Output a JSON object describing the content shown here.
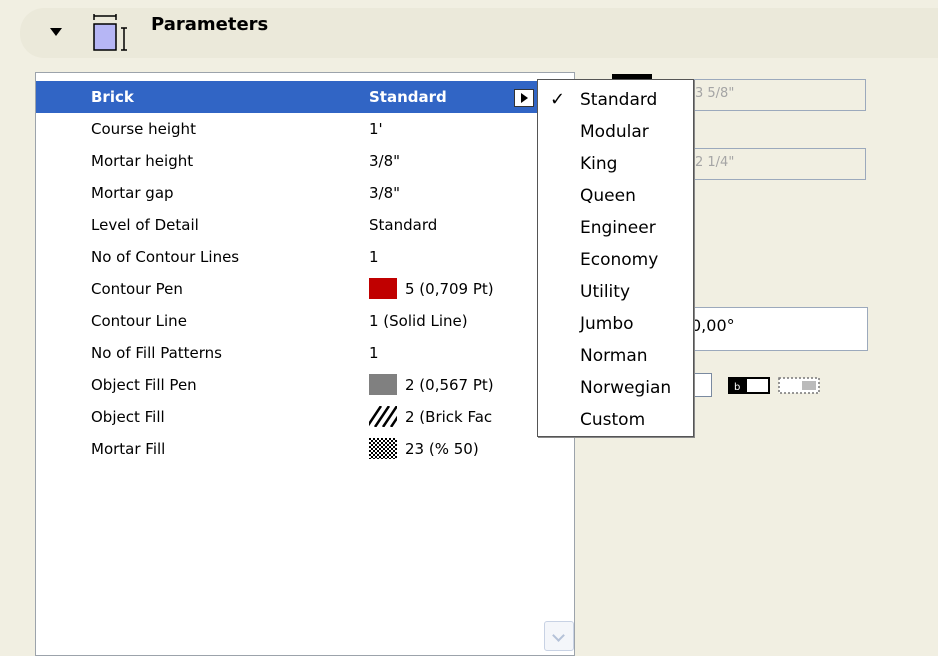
{
  "section": {
    "title": "Parameters"
  },
  "params": [
    {
      "name": "Brick",
      "value": "Standard",
      "selected": true
    },
    {
      "name": "Course height",
      "value": "1'"
    },
    {
      "name": "Mortar height",
      "value": "3/8\""
    },
    {
      "name": "Mortar gap",
      "value": "3/8\""
    },
    {
      "name": "Level of Detail",
      "value": "Standard"
    },
    {
      "name": "No of Contour Lines",
      "value": "1"
    },
    {
      "name": "Contour Pen",
      "value": "5 (0,709 Pt)",
      "swatch_color": "#c00000"
    },
    {
      "name": "Contour Line",
      "value": "1 (Solid Line)"
    },
    {
      "name": "No of Fill Patterns",
      "value": "1"
    },
    {
      "name": "Object Fill Pen",
      "value": "2 (0,567 Pt)",
      "swatch_color": "#808080"
    },
    {
      "name": "Object Fill",
      "value": "2 (Brick Fac",
      "swatch_pattern": "hatch"
    },
    {
      "name": "Mortar Fill",
      "value": "23 (% 50)",
      "swatch_pattern": "checker"
    }
  ],
  "dropdown": {
    "checkmark": "✓",
    "selected": "Standard",
    "items": [
      "Standard",
      "Modular",
      "King",
      "Queen",
      "Engineer",
      "Economy",
      "Utility",
      "Jumbo",
      "Norman",
      "Norwegian",
      "Custom"
    ]
  },
  "side_fields": {
    "field1": "3 5/8\"",
    "field2": "2 1/4\"",
    "angle": "0,00°"
  }
}
